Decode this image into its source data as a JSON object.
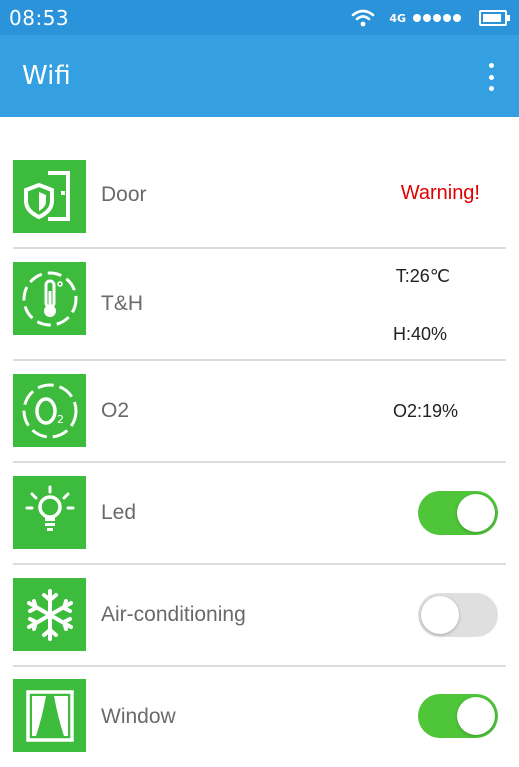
{
  "status_bar": {
    "time": "08:53",
    "network": "4G"
  },
  "app_bar": {
    "title": "Wifi"
  },
  "rows": {
    "door": {
      "label": "Door",
      "value": "Warning!",
      "icon": "door-shield-icon"
    },
    "th": {
      "label": "T&H",
      "temp": "T:26℃",
      "humidity": "H:40%",
      "icon": "thermometer-icon"
    },
    "o2": {
      "label": "O2",
      "value": "O2:19%",
      "icon": "o2-icon"
    },
    "led": {
      "label": "Led",
      "state": "on",
      "icon": "lightbulb-icon"
    },
    "ac": {
      "label": "Air-conditioning",
      "state": "off",
      "icon": "snowflake-icon"
    },
    "window": {
      "label": "Window",
      "state": "on",
      "icon": "window-curtain-icon"
    }
  },
  "colors": {
    "status_bar": "#2a93d9",
    "app_bar": "#34a0e2",
    "icon_bg": "#3dbb3d",
    "toggle_on": "#4fc53a",
    "toggle_off": "#dfdfdf",
    "warning": "#e00000"
  }
}
